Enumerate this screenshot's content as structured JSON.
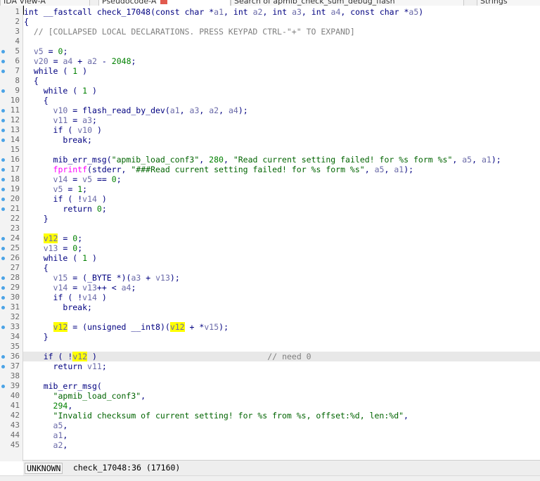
{
  "tabs": [
    {
      "label": "IDA View-A"
    },
    {
      "label": "Pseudocode-A"
    },
    {
      "label": "Search of apmib_check_sum_debug_flash"
    },
    {
      "label": "Strings"
    }
  ],
  "status": {
    "unknown_label": "UNKNOWN",
    "function_pos": "check_17048:36",
    "offset": "(17160)"
  },
  "code_lines": [
    {
      "n": "1",
      "dot": false,
      "text": "int __fastcall check_17048(const char *a1, int a2, int a3, int a4, const char *a5)"
    },
    {
      "n": "2",
      "dot": false,
      "text": "{"
    },
    {
      "n": "3",
      "dot": false,
      "text": "  // [COLLAPSED LOCAL DECLARATIONS. PRESS KEYPAD CTRL-\"+\" TO EXPAND]"
    },
    {
      "n": "4",
      "dot": false,
      "text": ""
    },
    {
      "n": "5",
      "dot": true,
      "text": "  v5 = 0;"
    },
    {
      "n": "6",
      "dot": true,
      "text": "  v20 = a4 + a2 - 2048;"
    },
    {
      "n": "7",
      "dot": true,
      "text": "  while ( 1 )"
    },
    {
      "n": "8",
      "dot": false,
      "text": "  {"
    },
    {
      "n": "9",
      "dot": true,
      "text": "    while ( 1 )"
    },
    {
      "n": "10",
      "dot": false,
      "text": "    {"
    },
    {
      "n": "11",
      "dot": true,
      "text": "      v10 = flash_read_by_dev(a1, a3, a2, a4);"
    },
    {
      "n": "12",
      "dot": true,
      "text": "      v11 = a3;"
    },
    {
      "n": "13",
      "dot": true,
      "text": "      if ( v10 )"
    },
    {
      "n": "14",
      "dot": true,
      "text": "        break;"
    },
    {
      "n": "15",
      "dot": false,
      "text": ""
    },
    {
      "n": "16",
      "dot": true,
      "text": "      mib_err_msg(\"apmib_load_conf3\", 280, \"Read current setting failed! for %s form %s\", a5, a1);"
    },
    {
      "n": "17",
      "dot": true,
      "text": "      fprintf(stderr, \"###Read current setting failed! for %s form %s\", a5, a1);"
    },
    {
      "n": "18",
      "dot": true,
      "text": "      v14 = v5 == 0;"
    },
    {
      "n": "19",
      "dot": true,
      "text": "      v5 = 1;"
    },
    {
      "n": "20",
      "dot": true,
      "text": "      if ( !v14 )"
    },
    {
      "n": "21",
      "dot": true,
      "text": "        return 0;"
    },
    {
      "n": "22",
      "dot": false,
      "text": "    }"
    },
    {
      "n": "23",
      "dot": false,
      "text": ""
    },
    {
      "n": "24",
      "dot": true,
      "text": "    v12 = 0;"
    },
    {
      "n": "25",
      "dot": true,
      "text": "    v13 = 0;"
    },
    {
      "n": "26",
      "dot": true,
      "text": "    while ( 1 )"
    },
    {
      "n": "27",
      "dot": false,
      "text": "    {"
    },
    {
      "n": "28",
      "dot": true,
      "text": "      v15 = (_BYTE *)(a3 + v13);"
    },
    {
      "n": "29",
      "dot": true,
      "text": "      v14 = v13++ < a4;"
    },
    {
      "n": "30",
      "dot": true,
      "text": "      if ( !v14 )"
    },
    {
      "n": "31",
      "dot": true,
      "text": "        break;"
    },
    {
      "n": "32",
      "dot": false,
      "text": ""
    },
    {
      "n": "33",
      "dot": true,
      "text": "      v12 = (unsigned __int8)(v12 + *v15);"
    },
    {
      "n": "34",
      "dot": false,
      "text": "    }"
    },
    {
      "n": "35",
      "dot": false,
      "text": ""
    },
    {
      "n": "36",
      "dot": true,
      "text": "    if ( !v12 )                                   // need 0"
    },
    {
      "n": "37",
      "dot": true,
      "text": "      return v11;"
    },
    {
      "n": "38",
      "dot": false,
      "text": ""
    },
    {
      "n": "39",
      "dot": true,
      "text": "    mib_err_msg("
    },
    {
      "n": "40",
      "dot": false,
      "text": "      \"apmib_load_conf3\","
    },
    {
      "n": "41",
      "dot": false,
      "text": "      294,"
    },
    {
      "n": "42",
      "dot": false,
      "text": "      \"Invalid checksum of current setting! for %s from %s, offset:%d, len:%d\","
    },
    {
      "n": "43",
      "dot": false,
      "text": "      a5,"
    },
    {
      "n": "44",
      "dot": false,
      "text": "      a1,"
    },
    {
      "n": "45",
      "dot": false,
      "text": "      a2,"
    }
  ]
}
